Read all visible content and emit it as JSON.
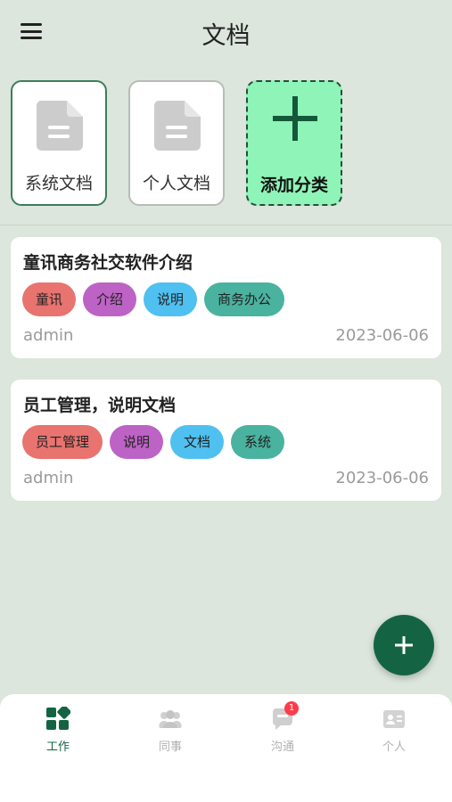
{
  "header": {
    "title": "文档",
    "menu_icon": "menu-icon"
  },
  "categories": [
    {
      "label": "系统文档",
      "icon": "document-icon",
      "active": true
    },
    {
      "label": "个人文档",
      "icon": "document-icon",
      "active": false
    },
    {
      "label": "添加分类",
      "icon": "plus-icon"
    }
  ],
  "documents": [
    {
      "title": "童讯商务社交软件介绍",
      "tags": [
        {
          "label": "童讯",
          "color": "#e8736f"
        },
        {
          "label": "介绍",
          "color": "#bd63c6"
        },
        {
          "label": "说明",
          "color": "#4fc0f0"
        },
        {
          "label": "商务办公",
          "color": "#49b3a0"
        }
      ],
      "author": "admin",
      "date": "2023-06-06"
    },
    {
      "title": "员工管理，说明文档",
      "tags": [
        {
          "label": "员工管理",
          "color": "#e8736f"
        },
        {
          "label": "说明",
          "color": "#bd63c6"
        },
        {
          "label": "文档",
          "color": "#4fc0f0"
        },
        {
          "label": "系统",
          "color": "#49b3a0"
        }
      ],
      "author": "admin",
      "date": "2023-06-06"
    }
  ],
  "fab": {
    "icon": "plus-icon"
  },
  "tabbar": {
    "items": [
      {
        "label": "工作",
        "icon": "work-icon",
        "active": true
      },
      {
        "label": "同事",
        "icon": "colleagues-icon",
        "active": false
      },
      {
        "label": "沟通",
        "icon": "chat-icon",
        "active": false,
        "badge": "1"
      },
      {
        "label": "个人",
        "icon": "profile-icon",
        "active": false
      }
    ]
  },
  "colors": {
    "accent": "#146444",
    "add_category_bg": "#8ef4b8",
    "background": "#dce6dc"
  }
}
